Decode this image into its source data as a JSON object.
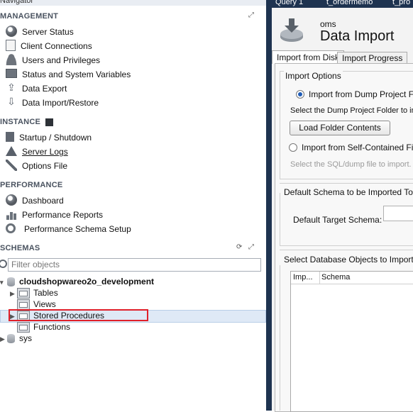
{
  "navigator": {
    "title": "Navigator",
    "management": {
      "heading": "MANAGEMENT",
      "items": [
        "Server Status",
        "Client Connections",
        "Users and Privileges",
        "Status and System Variables",
        "Data Export",
        "Data Import/Restore"
      ]
    },
    "instance": {
      "heading": "INSTANCE",
      "items": [
        "Startup / Shutdown",
        "Server Logs",
        "Options File"
      ]
    },
    "performance": {
      "heading": "PERFORMANCE",
      "items": [
        "Dashboard",
        "Performance Reports",
        "Performance Schema Setup"
      ]
    },
    "schemas": {
      "heading": "SCHEMAS",
      "filter_placeholder": "Filter objects",
      "db_name": "cloudshopwareo2o_development",
      "children": [
        "Tables",
        "Views",
        "Stored Procedures",
        "Functions"
      ],
      "other_db": "sys"
    }
  },
  "query_tabs": [
    "Query 1",
    "t_ordermemo",
    "t_pro"
  ],
  "data_import": {
    "connection": "oms",
    "title": "Data Import",
    "tabs": [
      "Import from Disk",
      "Import Progress"
    ],
    "import_options_heading": "Import Options",
    "opt_dump_folder": "Import from Dump Project Fold",
    "select_dump_folder": "Select the Dump Project Folder to im",
    "load_folder_button": "Load Folder Contents",
    "opt_self_contained": "Import from Self-Contained File",
    "select_sql_file": "Select the SQL/dump file to import. P",
    "default_schema_heading": "Default Schema to be Imported To",
    "default_target_label": "Default Target Schema:",
    "select_objects_heading": "Select Database Objects to Import (or",
    "columns": [
      "Imp...",
      "Schema"
    ]
  }
}
